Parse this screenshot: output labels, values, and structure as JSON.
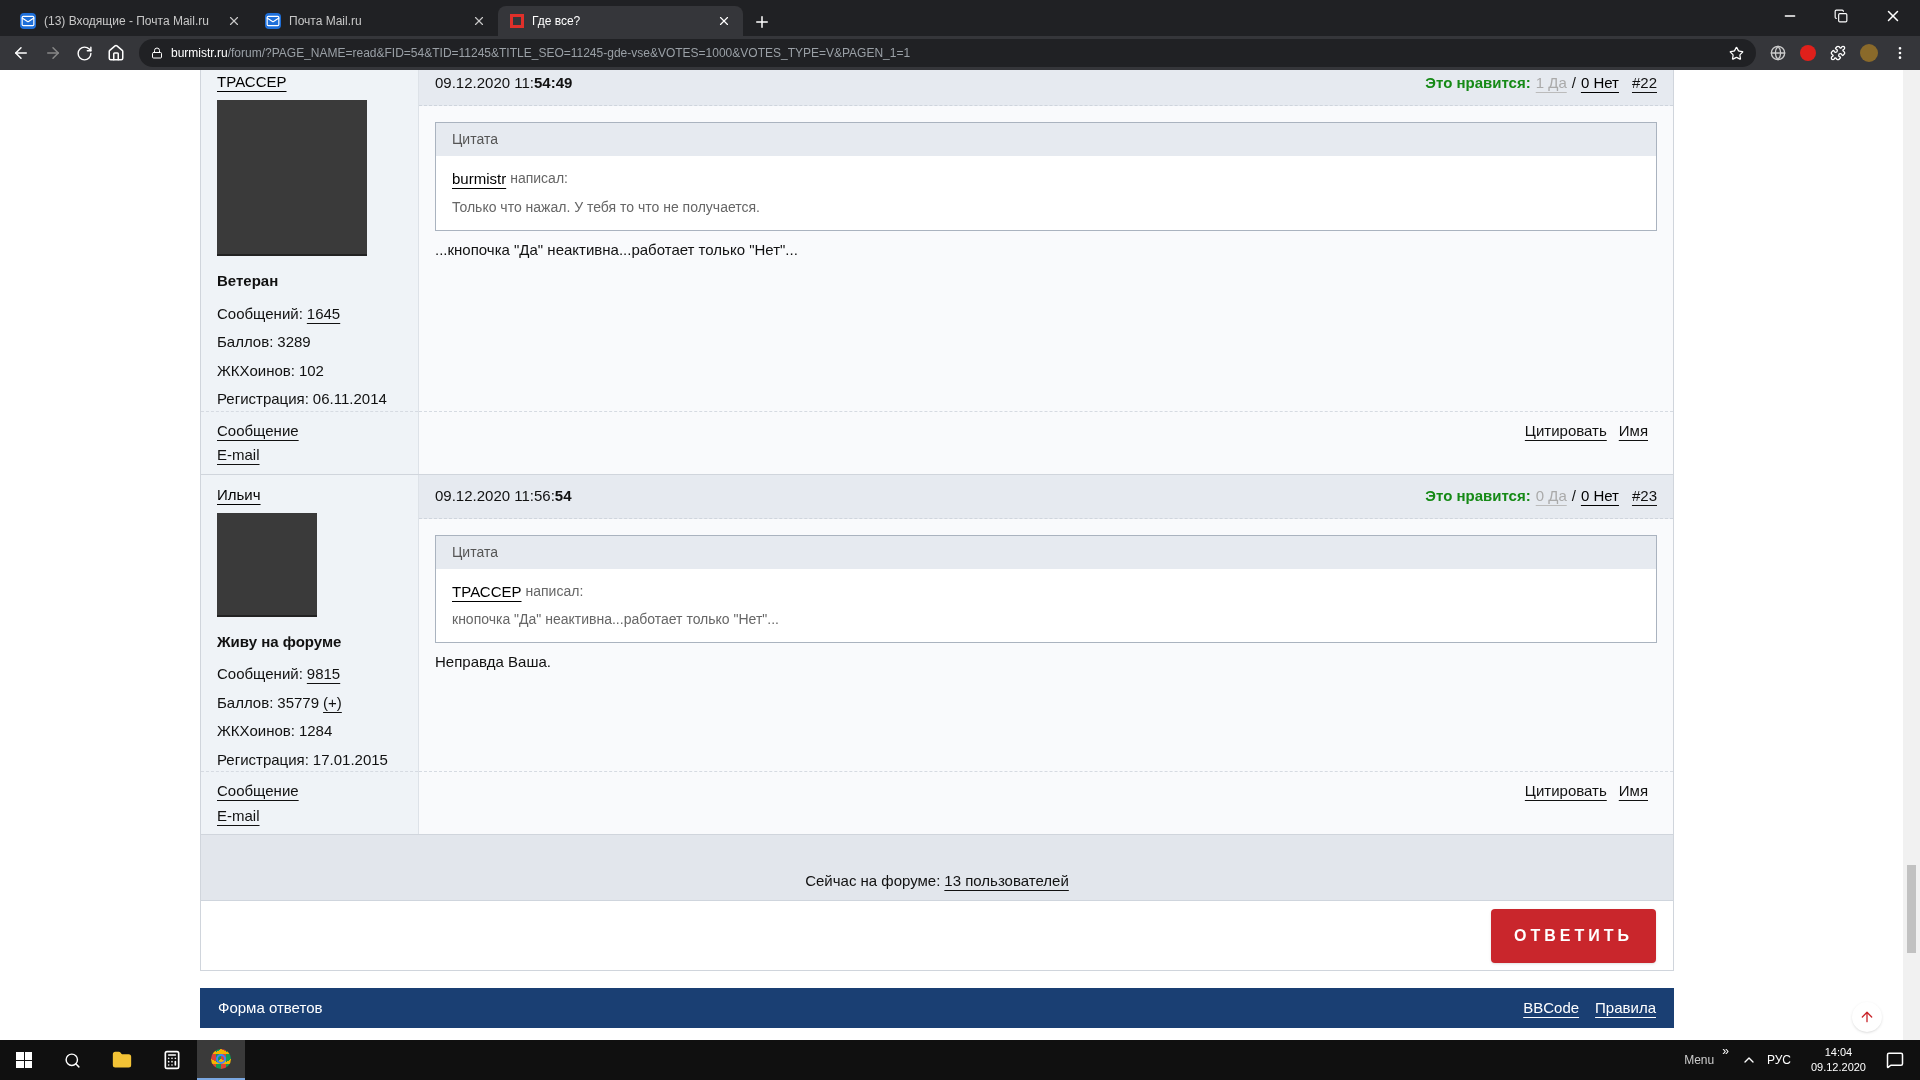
{
  "browser": {
    "tabs": [
      {
        "title": "(13) Входящие - Почта Mail.ru",
        "kind": "mail",
        "selected": false
      },
      {
        "title": "Почта Mail.ru",
        "kind": "mail",
        "selected": false
      },
      {
        "title": "Где все?",
        "kind": "site",
        "selected": true
      }
    ],
    "url_host": "burmistr.ru",
    "url_path": "/forum/?PAGE_NAME=read&FID=54&TID=11245&TITLE_SEO=11245-gde-vse&VOTES=1000&VOTES_TYPE=V&PAGEN_1=1"
  },
  "posts": [
    {
      "author": "ТРАССЕР",
      "rank": "Ветеран",
      "stats": [
        {
          "label": "Сообщений:",
          "value": "1645",
          "link": true
        },
        {
          "label": "Баллов:",
          "value": "3289",
          "link": false
        },
        {
          "label": "ЖКХоинов:",
          "value": "102",
          "link": false
        },
        {
          "label": "Регистрация:",
          "value": "06.11.2014",
          "link": false
        }
      ],
      "date": "09.12.2020 11:",
      "time_bold": "54:49",
      "likes_label": "Это нравится:",
      "yes": {
        "text": "1 Да",
        "disabled": true
      },
      "separator": "/",
      "no": {
        "text": "0 Нет",
        "disabled": false
      },
      "number": "#22",
      "quote_title": "Цитата",
      "quote_author": "burmistr",
      "quote_wrote": "написал:",
      "quote_text": "Только что нажал. У тебя то что не получается.",
      "text": "...кнопочка \"Да\" неактивна...работает только \"Нет\"...",
      "links": [
        "Сообщение",
        "E-mail"
      ],
      "actions": [
        "Цитировать",
        "Имя"
      ]
    },
    {
      "author": "Ильич",
      "rank": "Живу на форуме",
      "stats": [
        {
          "label": "Сообщений:",
          "value": "9815",
          "link": true
        },
        {
          "label": "Баллов:",
          "value": "35779",
          "link": false
        },
        {
          "label": "ЖКХоинов:",
          "value": "1284",
          "link": false
        },
        {
          "label": "Регистрация:",
          "value": "17.01.2015",
          "link": false
        }
      ],
      "plus": "(+)",
      "date": "09.12.2020 11:56:",
      "time_bold": "54",
      "likes_label": "Это нравится:",
      "yes": {
        "text": "0 Да",
        "disabled": true
      },
      "separator": "/",
      "no": {
        "text": "0 Нет",
        "disabled": false
      },
      "number": "#23",
      "quote_title": "Цитата",
      "quote_author": "ТРАССЕР",
      "quote_wrote": "написал:",
      "quote_text": "кнопочка \"Да\" неактивна...работает только \"Нет\"...",
      "text": "Неправда Ваша.",
      "links": [
        "Сообщение",
        "E-mail"
      ],
      "actions": [
        "Цитировать",
        "Имя"
      ]
    }
  ],
  "online": {
    "label": "Сейчас на форуме:",
    "link": "13 пользователей"
  },
  "reply_button": "ОТВЕТИТЬ",
  "form_bar": {
    "title": "Форма ответов",
    "links": [
      "BBCode",
      "Правила"
    ]
  },
  "taskbar": {
    "menu": "Menu",
    "chevron": "»",
    "lang": "РУС",
    "time": "14:04",
    "date": "09.12.2020"
  }
}
